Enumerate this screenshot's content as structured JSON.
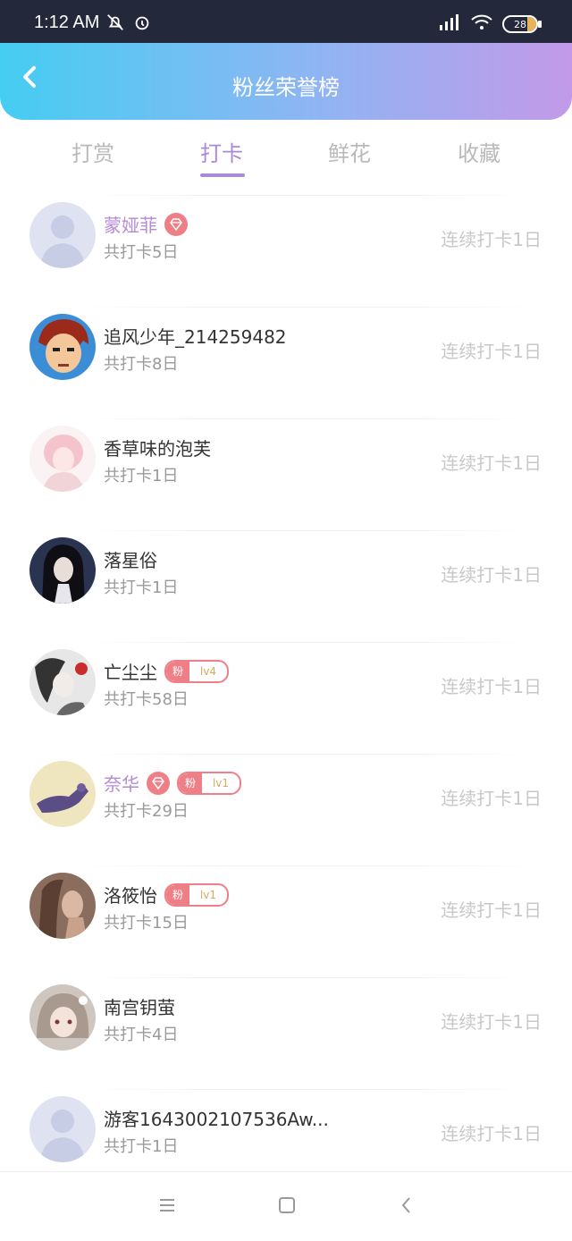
{
  "status": {
    "time": "1:12 AM",
    "battery": "28"
  },
  "header": {
    "title": "粉丝荣誉榜"
  },
  "tabs": [
    "打赏",
    "打卡",
    "鲜花",
    "收藏"
  ],
  "rows": [
    {
      "name": "蒙娅菲",
      "sub": "共打卡5日",
      "right": "连续打卡1日"
    },
    {
      "name": "追风少年_214259482",
      "sub": "共打卡8日",
      "right": "连续打卡1日"
    },
    {
      "name": "香草味的泡芙",
      "sub": "共打卡1日",
      "right": "连续打卡1日"
    },
    {
      "name": "落星俗",
      "sub": "共打卡1日",
      "right": "连续打卡1日"
    },
    {
      "name": "亡尘尘",
      "sub": "共打卡58日",
      "right": "连续打卡1日",
      "fan_label": "粉",
      "level": "lv4"
    },
    {
      "name": "奈华",
      "sub": "共打卡29日",
      "right": "连续打卡1日",
      "fan_label": "粉",
      "level": "lv1"
    },
    {
      "name": "洛筱怡",
      "sub": "共打卡15日",
      "right": "连续打卡1日",
      "fan_label": "粉",
      "level": "lv1"
    },
    {
      "name": "南宫钥萤",
      "sub": "共打卡4日",
      "right": "连续打卡1日"
    },
    {
      "name": "游客1643002107536Aw...",
      "sub": "共打卡1日",
      "right": "连续打卡1日"
    }
  ],
  "colors": {
    "accent": "#a98ad6",
    "vip_name": "#b58ad6",
    "badge": "#ef7f86"
  }
}
